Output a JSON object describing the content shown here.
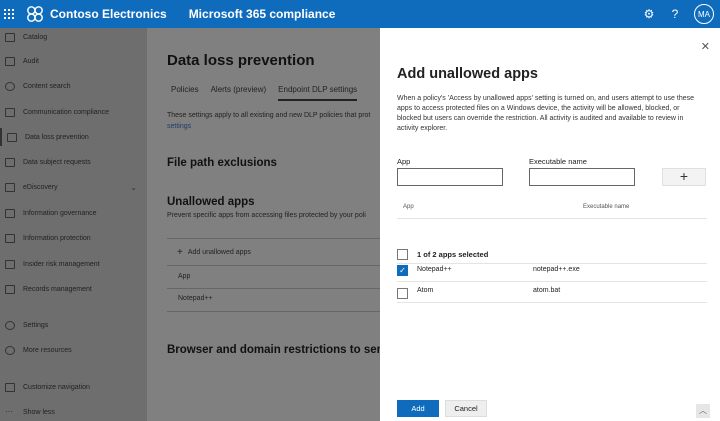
{
  "topbar": {
    "org_name": "Contoso Electronics",
    "app_name": "Microsoft 365 compliance",
    "avatar_initials": "MA",
    "accent": "#0f6cbd"
  },
  "sidebar": {
    "items": [
      {
        "label": "Catalog",
        "icon": "catalog-icon"
      },
      {
        "label": "Audit",
        "icon": "audit-icon"
      },
      {
        "label": "Content search",
        "icon": "search-icon"
      },
      {
        "label": "Communication compliance",
        "icon": "chat-icon"
      },
      {
        "label": "Data loss prevention",
        "icon": "shield-icon",
        "active": true
      },
      {
        "label": "Data subject requests",
        "icon": "document-icon"
      },
      {
        "label": "eDiscovery",
        "icon": "ediscovery-icon",
        "expandable": true
      },
      {
        "label": "Information governance",
        "icon": "governance-icon"
      },
      {
        "label": "Information protection",
        "icon": "lock-icon"
      },
      {
        "label": "Insider risk management",
        "icon": "person-icon"
      },
      {
        "label": "Records management",
        "icon": "records-icon"
      },
      {
        "label": "Settings",
        "icon": "gear-icon"
      },
      {
        "label": "More resources",
        "icon": "info-icon"
      },
      {
        "label": "Customize navigation",
        "icon": "pencil-icon"
      },
      {
        "label": "Show less",
        "icon": "ellipsis-icon"
      }
    ]
  },
  "main": {
    "title": "Data loss prevention",
    "tabs": [
      "Policies",
      "Alerts (preview)",
      "Endpoint DLP settings"
    ],
    "description_line1": "These settings apply to all existing and new DLP policies that prot",
    "description_link": "settings",
    "file_path_heading": "File path exclusions",
    "unallowed_heading": "Unallowed apps",
    "unallowed_desc": "Prevent specific apps from accessing files protected by your poli",
    "add_button": "Add unallowed apps",
    "list_header": "App",
    "list_row": "Notepad++",
    "browser_heading": "Browser and domain restrictions to sen"
  },
  "panel": {
    "title": "Add unallowed apps",
    "description": "When a policy's 'Access by unallowed apps' setting is turned on, and users attempt to use these apps to access protected files on a Windows device, the activity will be allowed, blocked, or blocked but users can override the restriction. All activity is audited and available to review in activity explorer.",
    "app_label": "App",
    "exec_label": "Executable name",
    "app_value": "",
    "exec_value": "",
    "add_icon": "plus-icon",
    "col_app": "App",
    "col_exec": "Executable name",
    "selection_text": "1 of 2 apps selected",
    "rows": [
      {
        "app": "Notepad++",
        "exe": "notepad++.exe",
        "checked": true
      },
      {
        "app": "Atom",
        "exe": "atom.bat",
        "checked": false
      }
    ],
    "add_label": "Add",
    "cancel_label": "Cancel"
  }
}
